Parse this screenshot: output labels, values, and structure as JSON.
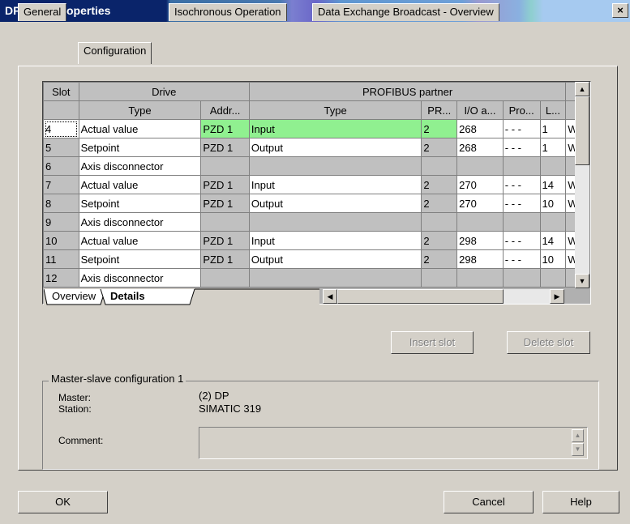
{
  "window": {
    "title": "DP slave properties",
    "close": "×"
  },
  "tabs": [
    {
      "label": "General"
    },
    {
      "label": "Configuration"
    },
    {
      "label": "Isochronous Operation"
    },
    {
      "label": "Data Exchange Broadcast - Overview"
    }
  ],
  "grid": {
    "header_groups": [
      "Slot",
      "Drive",
      "PROFIBUS partner"
    ],
    "columns": [
      "Type",
      "Addr...",
      "Type",
      "PR...",
      "I/O a...",
      "Pro...",
      "L..."
    ],
    "rows": [
      {
        "slot": "4",
        "drive_type": "Actual value",
        "addr": "PZD 1",
        "pb_type": "Input",
        "pr": "2",
        "io": "268",
        "pro": "- - -",
        "l": "1",
        "u": "W"
      },
      {
        "slot": "5",
        "drive_type": "Setpoint",
        "addr": "PZD 1",
        "pb_type": "Output",
        "pr": "2",
        "io": "268",
        "pro": "- - -",
        "l": "1",
        "u": "W"
      },
      {
        "slot": "6",
        "drive_type": "Axis disconnector",
        "addr": "",
        "pb_type": "",
        "pr": "",
        "io": "",
        "pro": "",
        "l": "",
        "u": ""
      },
      {
        "slot": "7",
        "drive_type": "Actual value",
        "addr": "PZD 1",
        "pb_type": "Input",
        "pr": "2",
        "io": "270",
        "pro": "- - -",
        "l": "14",
        "u": "W"
      },
      {
        "slot": "8",
        "drive_type": "Setpoint",
        "addr": "PZD 1",
        "pb_type": "Output",
        "pr": "2",
        "io": "270",
        "pro": "- - -",
        "l": "10",
        "u": "W"
      },
      {
        "slot": "9",
        "drive_type": "Axis disconnector",
        "addr": "",
        "pb_type": "",
        "pr": "",
        "io": "",
        "pro": "",
        "l": "",
        "u": ""
      },
      {
        "slot": "10",
        "drive_type": "Actual value",
        "addr": "PZD 1",
        "pb_type": "Input",
        "pr": "2",
        "io": "298",
        "pro": "- - -",
        "l": "14",
        "u": "W"
      },
      {
        "slot": "11",
        "drive_type": "Setpoint",
        "addr": "PZD 1",
        "pb_type": "Output",
        "pr": "2",
        "io": "298",
        "pro": "- - -",
        "l": "10",
        "u": "W"
      },
      {
        "slot": "12",
        "drive_type": "Axis disconnector",
        "addr": "",
        "pb_type": "",
        "pr": "",
        "io": "",
        "pro": "",
        "l": "",
        "u": ""
      }
    ],
    "sheet_tabs": [
      {
        "label": "Overview"
      },
      {
        "label": "Details"
      }
    ]
  },
  "buttons": {
    "insert_slot": "Insert slot",
    "delete_slot": "Delete slot",
    "ok": "OK",
    "cancel": "Cancel",
    "help": "Help"
  },
  "master_slave": {
    "group_title": "Master-slave configuration 1",
    "master_label": "Master:",
    "station_label": "Station:",
    "master_value": "(2) DP",
    "station_value": "SIMATIC 319",
    "comment_label": "Comment:",
    "comment_value": ""
  },
  "colors": {
    "title_bar": "#0a246a",
    "selected_row": "#90f090",
    "dialog_bg": "#d4d0c8"
  }
}
